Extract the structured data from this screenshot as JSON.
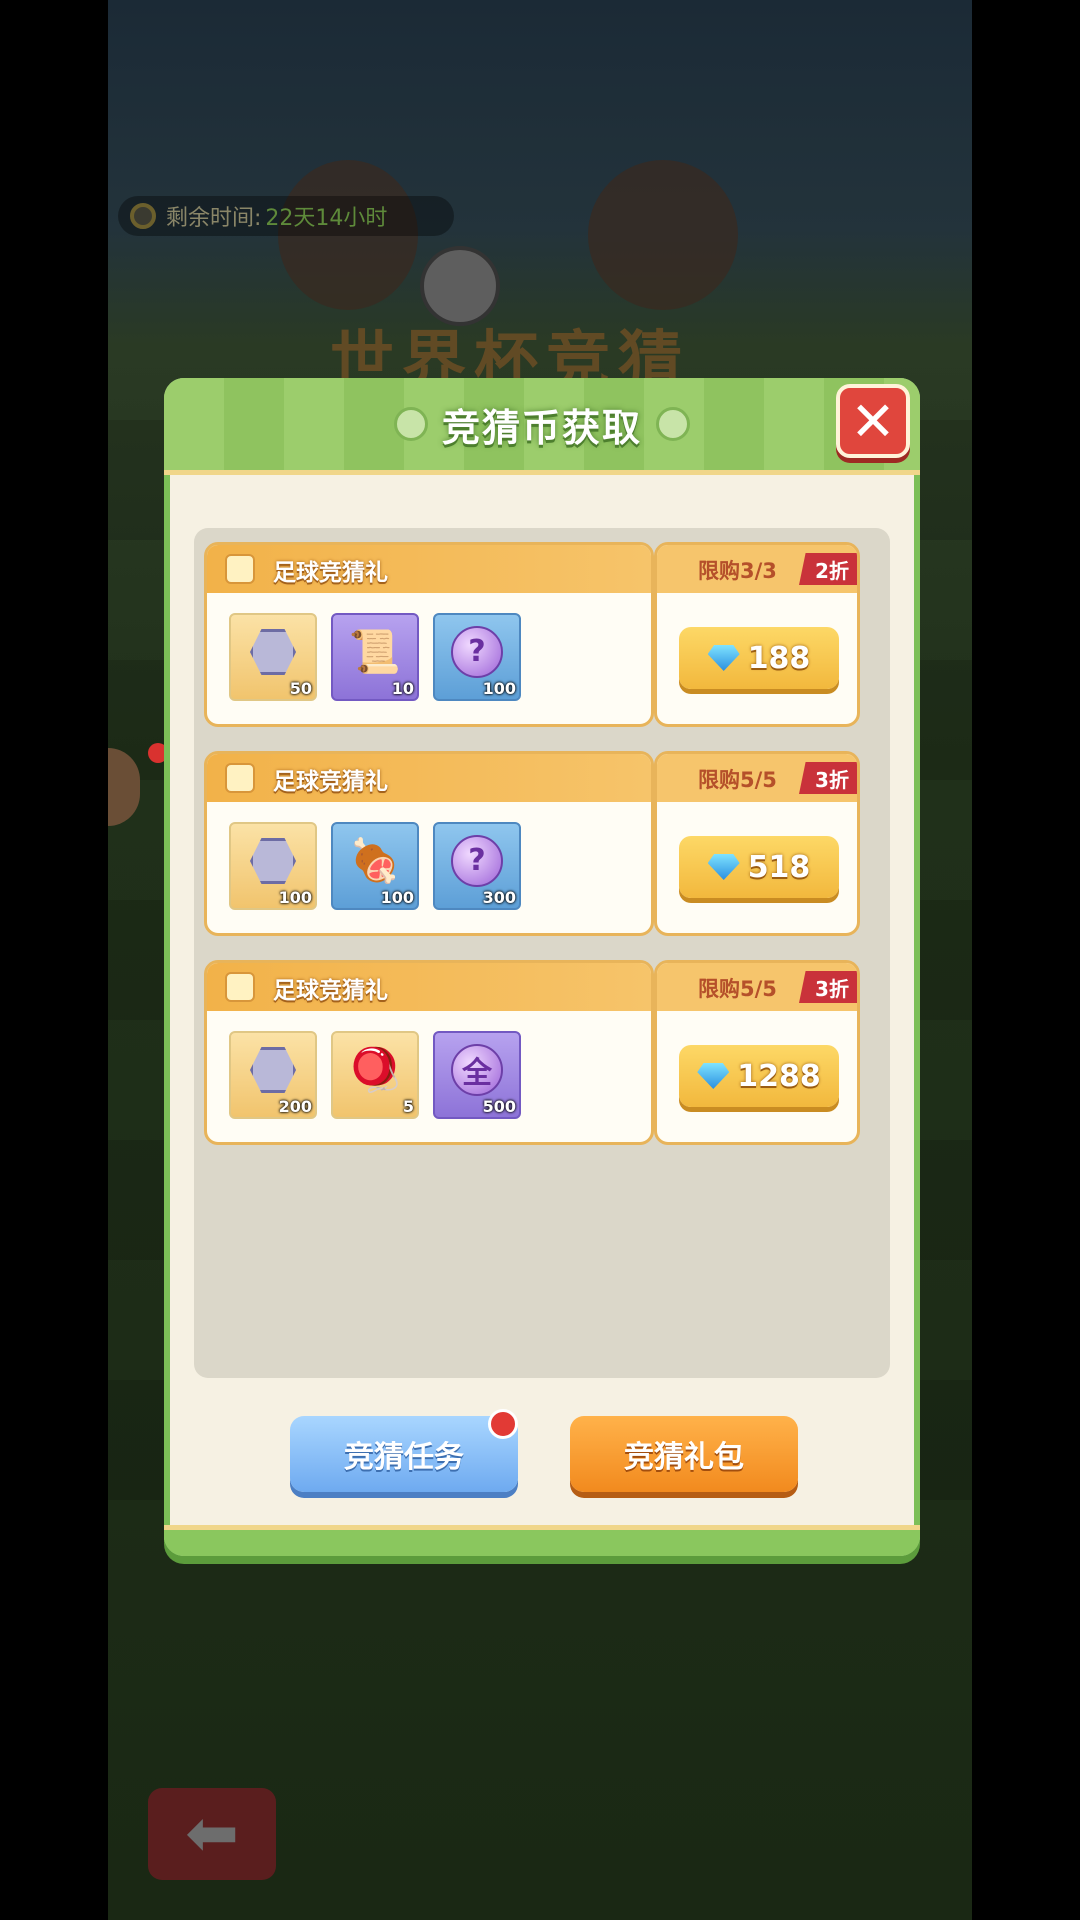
{
  "background": {
    "timer_label": "剩余时间:",
    "timer_value": "22天14小时",
    "event_title": "世界杯竞猜",
    "back_icon": "arrow-left-icon"
  },
  "dialog": {
    "title": "竞猜币获取",
    "close_icon": "close-icon",
    "packs": [
      {
        "name": "足球竞猜礼",
        "limit": "限购3/3",
        "discount": "2折",
        "price": "188",
        "items": [
          {
            "icon": "hexagon-coin-icon",
            "qty": "50",
            "style": "gold"
          },
          {
            "icon": "scroll-ticket-icon",
            "qty": "10",
            "style": "purple"
          },
          {
            "icon": "mystery-orb-icon",
            "qty": "100",
            "style": "blue"
          }
        ]
      },
      {
        "name": "足球竞猜礼",
        "limit": "限购5/5",
        "discount": "3折",
        "price": "518",
        "items": [
          {
            "icon": "hexagon-coin-icon",
            "qty": "100",
            "style": "gold"
          },
          {
            "icon": "meat-icon",
            "qty": "100",
            "style": "blue"
          },
          {
            "icon": "mystery-orb-icon",
            "qty": "300",
            "style": "blue"
          }
        ]
      },
      {
        "name": "足球竞猜礼",
        "limit": "限购5/5",
        "discount": "3折",
        "price": "1288",
        "items": [
          {
            "icon": "hexagon-coin-icon",
            "qty": "200",
            "style": "gold"
          },
          {
            "icon": "spinning-top-icon",
            "qty": "5",
            "style": "gold"
          },
          {
            "icon": "all-orb-icon",
            "qty": "500",
            "style": "purple",
            "glyph": "全"
          }
        ]
      }
    ],
    "tasks_button": "竞猜任务",
    "gift_pack_button": "竞猜礼包"
  },
  "colors": {
    "header_green": "#9ccd6c",
    "card_orange": "#f2b249",
    "discount_red": "#c9323a",
    "price_gold": "#fdd866"
  }
}
